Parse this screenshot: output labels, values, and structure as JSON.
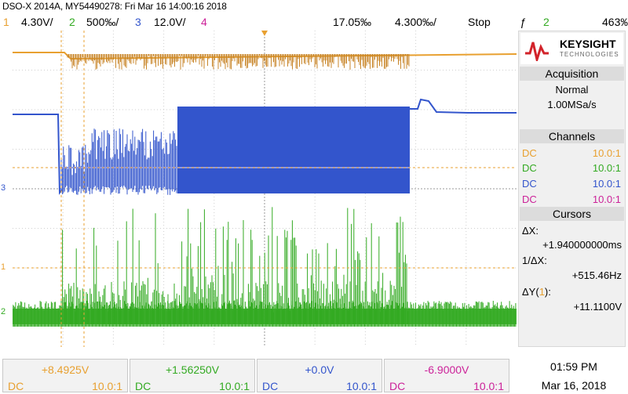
{
  "header": {
    "title": "DSO-X 2014A, MY54490278: Fri Mar 16 14:00:16 2018"
  },
  "status_bar": {
    "ch1_num": "1",
    "ch1_scale": "4.30V/",
    "ch2_num": "2",
    "ch2_scale": "500‰/",
    "ch3_num": "3",
    "ch3_scale": "12.0V/",
    "ch4_num": "4",
    "time_pos": "17.05‰",
    "time_scale": "4.300‰/",
    "run_state": "Stop",
    "trigger_icon": "ƒ",
    "trigger_source": "2",
    "trigger_level": "463‰"
  },
  "colors": {
    "ch1": "#e8a030",
    "ch2": "#33aa22",
    "ch3": "#3355cc",
    "ch4": "#cc2299",
    "logo": "#d2232a"
  },
  "logo": {
    "name": "KEYSIGHT",
    "sub": "TECHNOLOGIES",
    "icon": "keysight-wave-logo"
  },
  "acquisition": {
    "title": "Acquisition",
    "mode": "Normal",
    "rate": "1.00MSa/s"
  },
  "channels": {
    "title": "Channels",
    "rows": [
      {
        "coupling": "DC",
        "probe": "10.0:1"
      },
      {
        "coupling": "DC",
        "probe": "10.0:1"
      },
      {
        "coupling": "DC",
        "probe": "10.0:1"
      },
      {
        "coupling": "DC",
        "probe": "10.0:1"
      }
    ]
  },
  "cursors": {
    "title": "Cursors",
    "dx_label": "ΔX:",
    "dx_value": "+1.940000000ms",
    "inv_label": "1/ΔX:",
    "inv_value": "+515.46Hz",
    "dy_label_pre": "ΔY(",
    "dy_ch": "1",
    "dy_label_post": "):",
    "dy_value": "+11.1100V"
  },
  "ground_markers": {
    "ch1": "1",
    "ch2": "2",
    "ch3": "3"
  },
  "bottom_channels": [
    {
      "offset": "+8.4925V",
      "coupling": "DC",
      "probe": "10.0:1"
    },
    {
      "offset": "+1.56250V",
      "coupling": "DC",
      "probe": "10.0:1"
    },
    {
      "offset": "+0.0V",
      "coupling": "DC",
      "probe": "10.0:1"
    },
    {
      "offset": "-6.9000V",
      "coupling": "DC",
      "probe": "10.0:1"
    }
  ],
  "clock": {
    "time": "01:59 PM",
    "date": "Mar 16, 2018"
  }
}
